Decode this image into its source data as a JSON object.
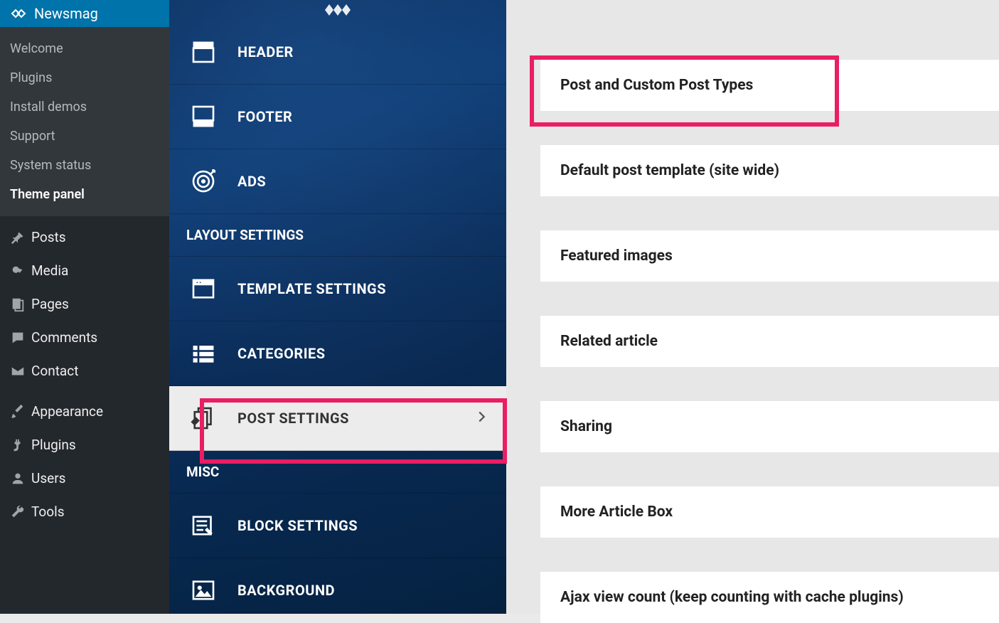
{
  "wp_sidebar": {
    "current_theme": "Newsmag",
    "submenu": [
      "Welcome",
      "Plugins",
      "Install demos",
      "Support",
      "System status",
      "Theme panel"
    ],
    "submenu_active": "Theme panel",
    "menu": [
      "Posts",
      "Media",
      "Pages",
      "Comments",
      "Contact",
      "Appearance",
      "Plugins",
      "Users",
      "Tools"
    ]
  },
  "settings_nav": {
    "items_top": [
      "HEADER",
      "FOOTER",
      "ADS"
    ],
    "section_layout": "LAYOUT SETTINGS",
    "items_layout": [
      "TEMPLATE SETTINGS",
      "CATEGORIES",
      "POST SETTINGS"
    ],
    "section_misc": "MISC",
    "items_misc": [
      "BLOCK SETTINGS",
      "BACKGROUND"
    ],
    "active": "POST SETTINGS"
  },
  "panel": {
    "blocks": [
      "Post and Custom Post Types",
      "Default post template (site wide)",
      "Featured images",
      "Related article",
      "Sharing",
      "More Article Box",
      "Ajax view count (keep counting with cache plugins)"
    ]
  }
}
